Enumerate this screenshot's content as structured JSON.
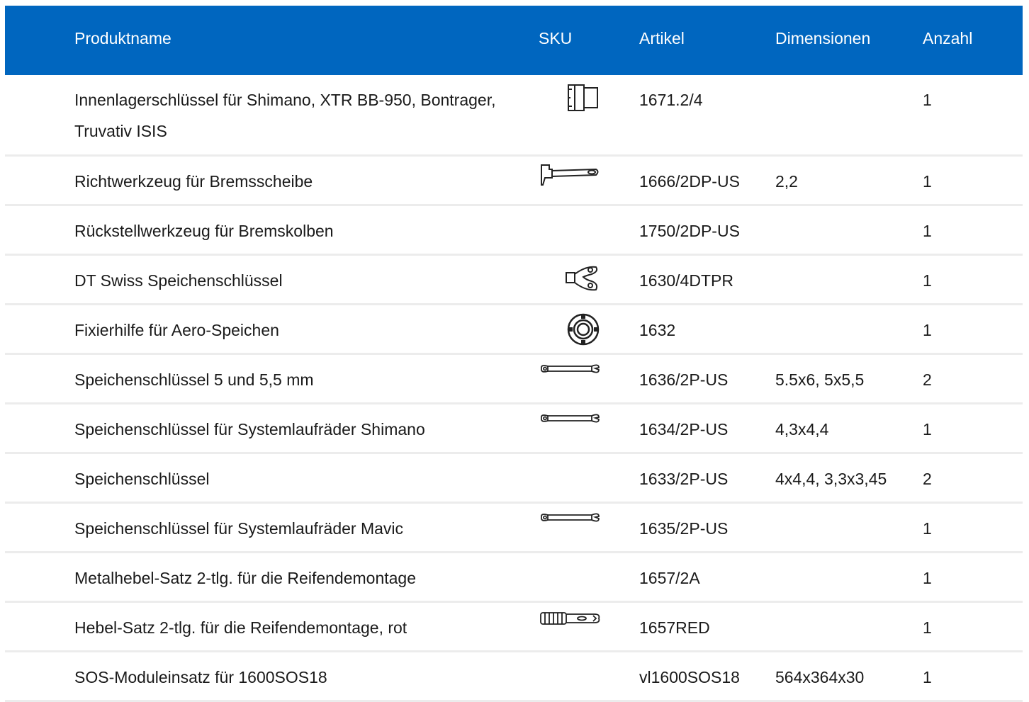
{
  "header": {
    "name": "Produktname",
    "sku": "SKU",
    "article": "Artikel",
    "dimensions": "Dimensionen",
    "quantity": "Anzahl"
  },
  "colors": {
    "header_bg": "#0066bf",
    "header_text": "#ffffff",
    "divider": "#ececec"
  },
  "rows": [
    {
      "name": "Innenlagerschlüssel für Shimano, XTR BB-950, Bontrager, Truvativ ISIS",
      "icon": "bottom-bracket-tool-icon",
      "article": "1671.2/4",
      "dimensions": "",
      "quantity": "1"
    },
    {
      "name": "Richtwerkzeug für Bremsscheibe",
      "icon": "rotor-truing-tool-icon",
      "article": "1666/2DP-US",
      "dimensions": "2,2",
      "quantity": "1"
    },
    {
      "name": "Rückstellwerkzeug für Bremskolben",
      "icon": "",
      "article": "1750/2DP-US",
      "dimensions": "",
      "quantity": "1"
    },
    {
      "name": "DT Swiss Speichenschlüssel",
      "icon": "dt-swiss-spoke-wrench-icon",
      "article": "1630/4DTPR",
      "dimensions": "",
      "quantity": "1"
    },
    {
      "name": "Fixierhilfe für Aero-Speichen",
      "icon": "aero-spoke-holder-icon",
      "article": "1632",
      "dimensions": "",
      "quantity": "1"
    },
    {
      "name": "Speichenschlüssel 5 und 5,5 mm",
      "icon": "spoke-wrench-icon",
      "article": "1636/2P-US",
      "dimensions": "5.5x6, 5x5,5",
      "quantity": "2"
    },
    {
      "name": "Speichenschlüssel für Systemlaufräder Shimano",
      "icon": "spoke-wrench-icon",
      "article": "1634/2P-US",
      "dimensions": "4,3x4,4",
      "quantity": "1"
    },
    {
      "name": "Speichenschlüssel",
      "icon": "",
      "article": "1633/2P-US",
      "dimensions": "4x4,4, 3,3x3,45",
      "quantity": "2"
    },
    {
      "name": "Speichenschlüssel für Systemlaufräder Mavic",
      "icon": "spoke-wrench-icon",
      "article": "1635/2P-US",
      "dimensions": "",
      "quantity": "1"
    },
    {
      "name": "Metalhebel-Satz 2-tlg. für die Reifendemontage",
      "icon": "",
      "article": "1657/2A",
      "dimensions": "",
      "quantity": "1"
    },
    {
      "name": "Hebel-Satz 2-tlg. für die Reifendemontage, rot",
      "icon": "tire-lever-icon",
      "article": "1657RED",
      "dimensions": "",
      "quantity": "1"
    },
    {
      "name": "SOS-Moduleinsatz für 1600SOS18",
      "icon": "",
      "article": "vl1600SOS18",
      "dimensions": "564x364x30",
      "quantity": "1"
    }
  ]
}
